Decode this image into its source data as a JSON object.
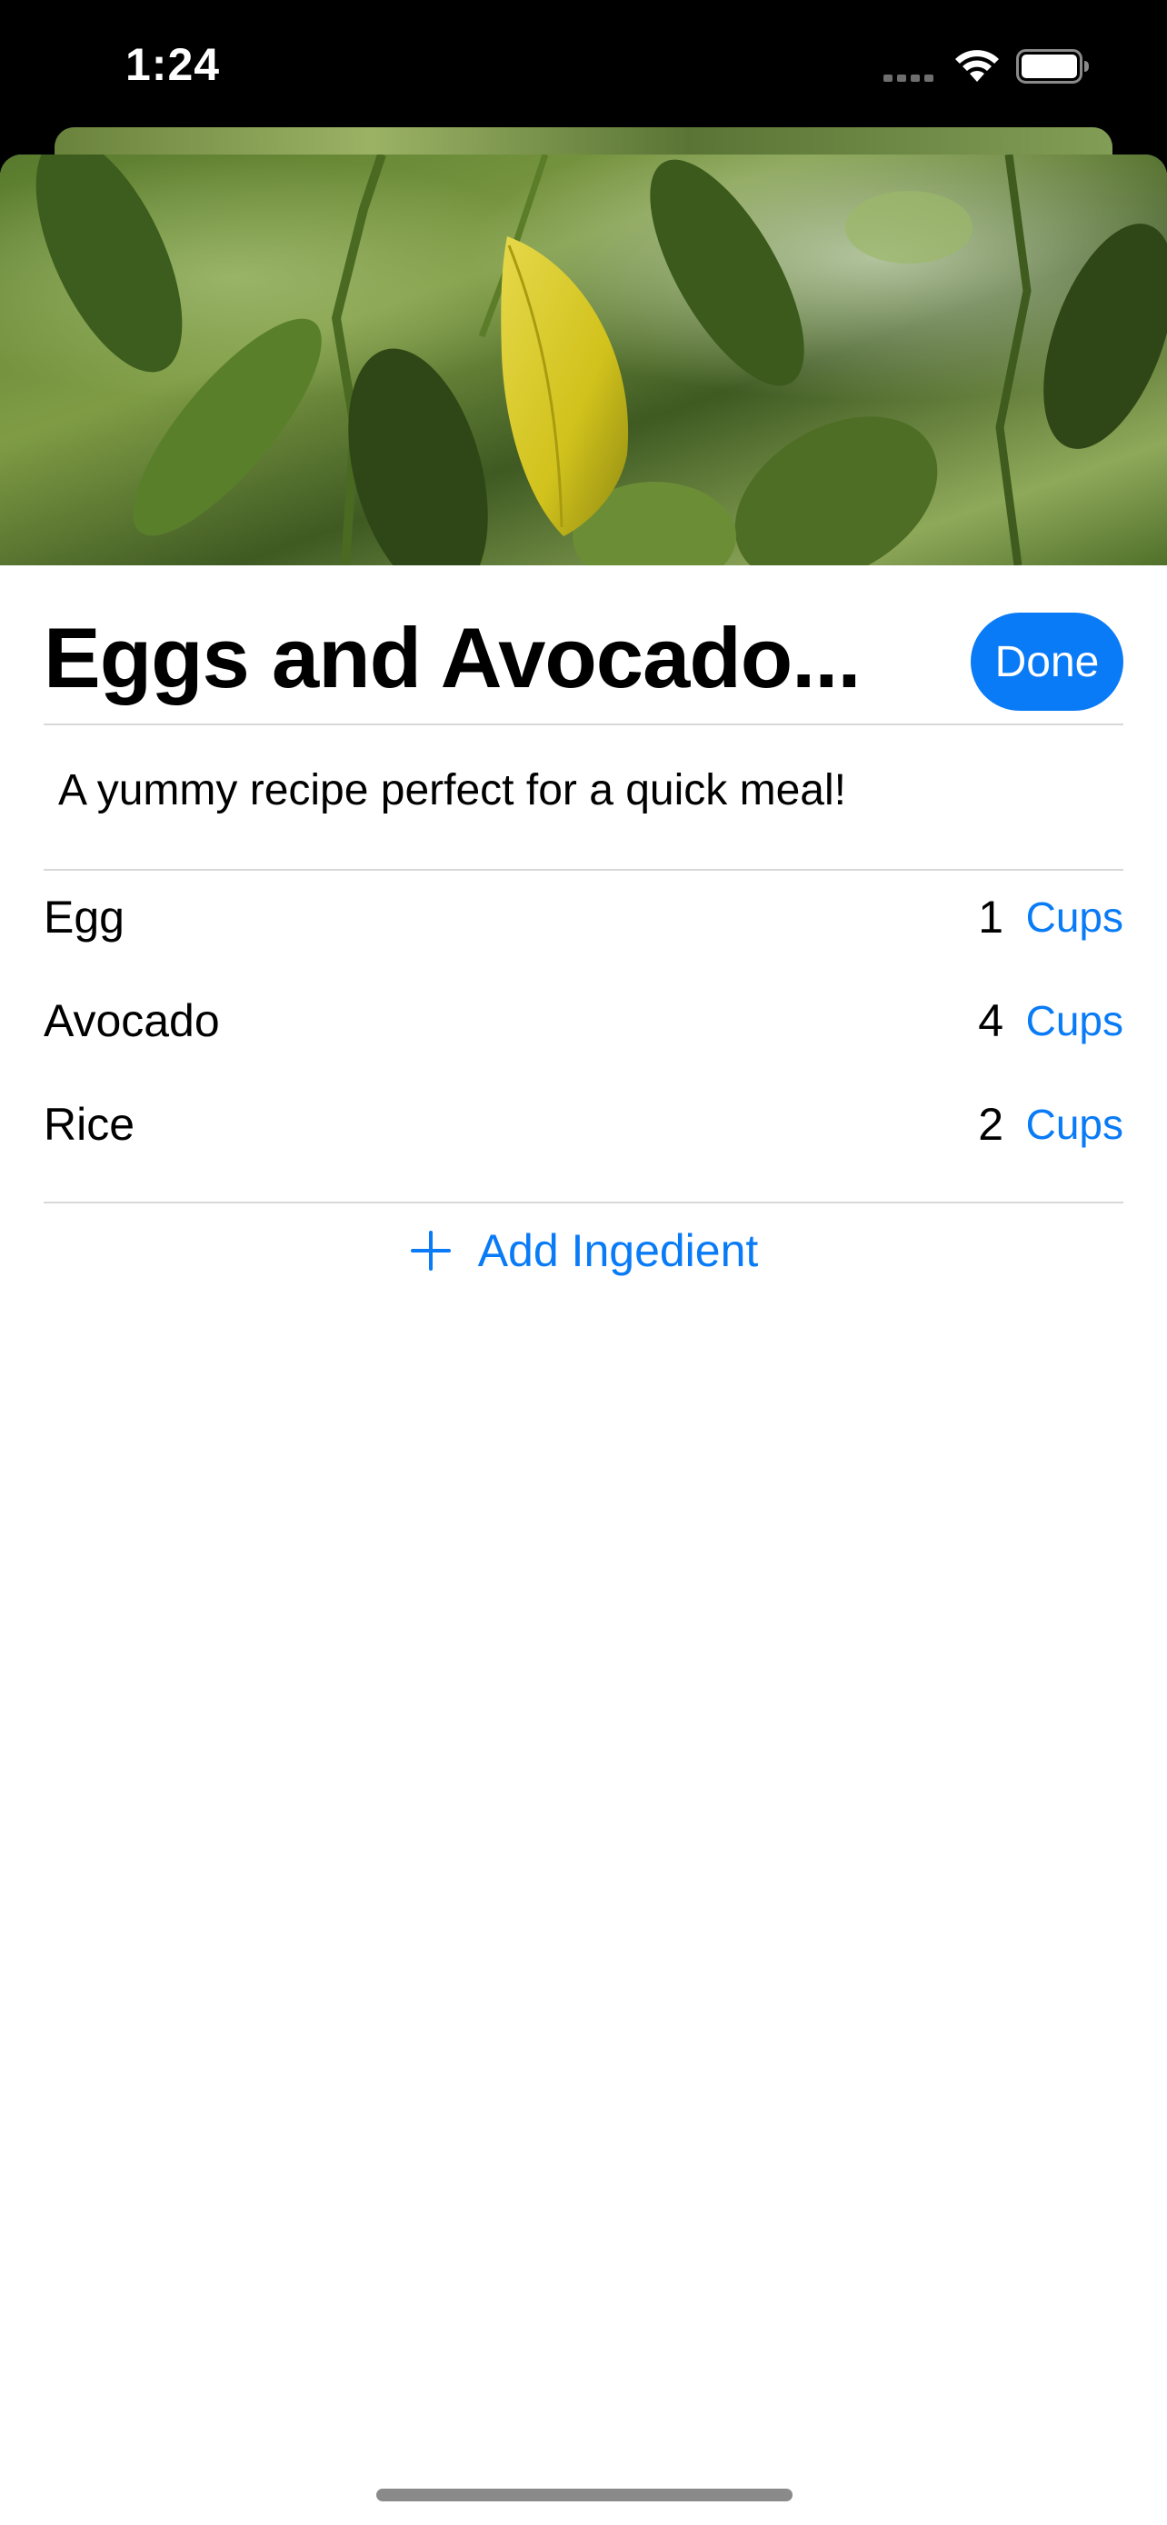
{
  "status_bar": {
    "time": "1:24"
  },
  "recipe": {
    "title": "Eggs and Avocado...",
    "description": "A yummy recipe perfect for a quick meal!",
    "done_label": "Done"
  },
  "ingredients": [
    {
      "name": "Egg",
      "quantity": "1",
      "unit": "Cups"
    },
    {
      "name": "Avocado",
      "quantity": "4",
      "unit": "Cups"
    },
    {
      "name": "Rice",
      "quantity": "2",
      "unit": "Cups"
    }
  ],
  "actions": {
    "add_ingredient_label": "Add Ingedient"
  },
  "colors": {
    "accent": "#0a7bf6",
    "divider": "#d8d8d8",
    "background": "#ffffff"
  },
  "icons": {
    "add": "plus-icon",
    "wifi": "wifi-icon",
    "battery": "battery-icon",
    "signal": "cellular-signal-icon"
  }
}
